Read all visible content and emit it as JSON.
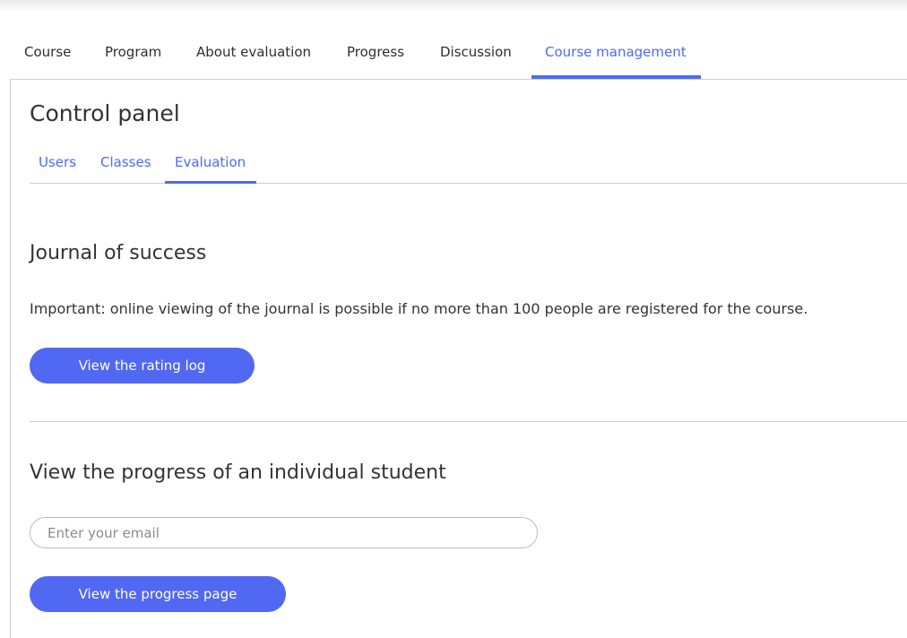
{
  "main_nav": {
    "tabs": [
      {
        "label": "Course",
        "active": false
      },
      {
        "label": "Program",
        "active": false
      },
      {
        "label": "About evaluation",
        "active": false
      },
      {
        "label": "Progress",
        "active": false
      },
      {
        "label": "Discussion",
        "active": false
      },
      {
        "label": "Course management",
        "active": true
      }
    ]
  },
  "control_panel": {
    "title": "Control panel",
    "tabs": [
      {
        "label": "Users",
        "active": false
      },
      {
        "label": "Classes",
        "active": false
      },
      {
        "label": "Evaluation",
        "active": true
      }
    ]
  },
  "journal": {
    "title": "Journal of success",
    "notice": "Important: online viewing of the journal is possible if no more than 100 people are registered for the course.",
    "button_label": "View the rating log"
  },
  "student_progress": {
    "title": "View the progress of an individual student",
    "email_placeholder": "Enter your email",
    "email_value": "",
    "button_label": "View the progress page"
  },
  "colors": {
    "accent": "#4b6cf2",
    "button": "#5168f3",
    "text": "#333333",
    "border": "#cfcfcf"
  }
}
